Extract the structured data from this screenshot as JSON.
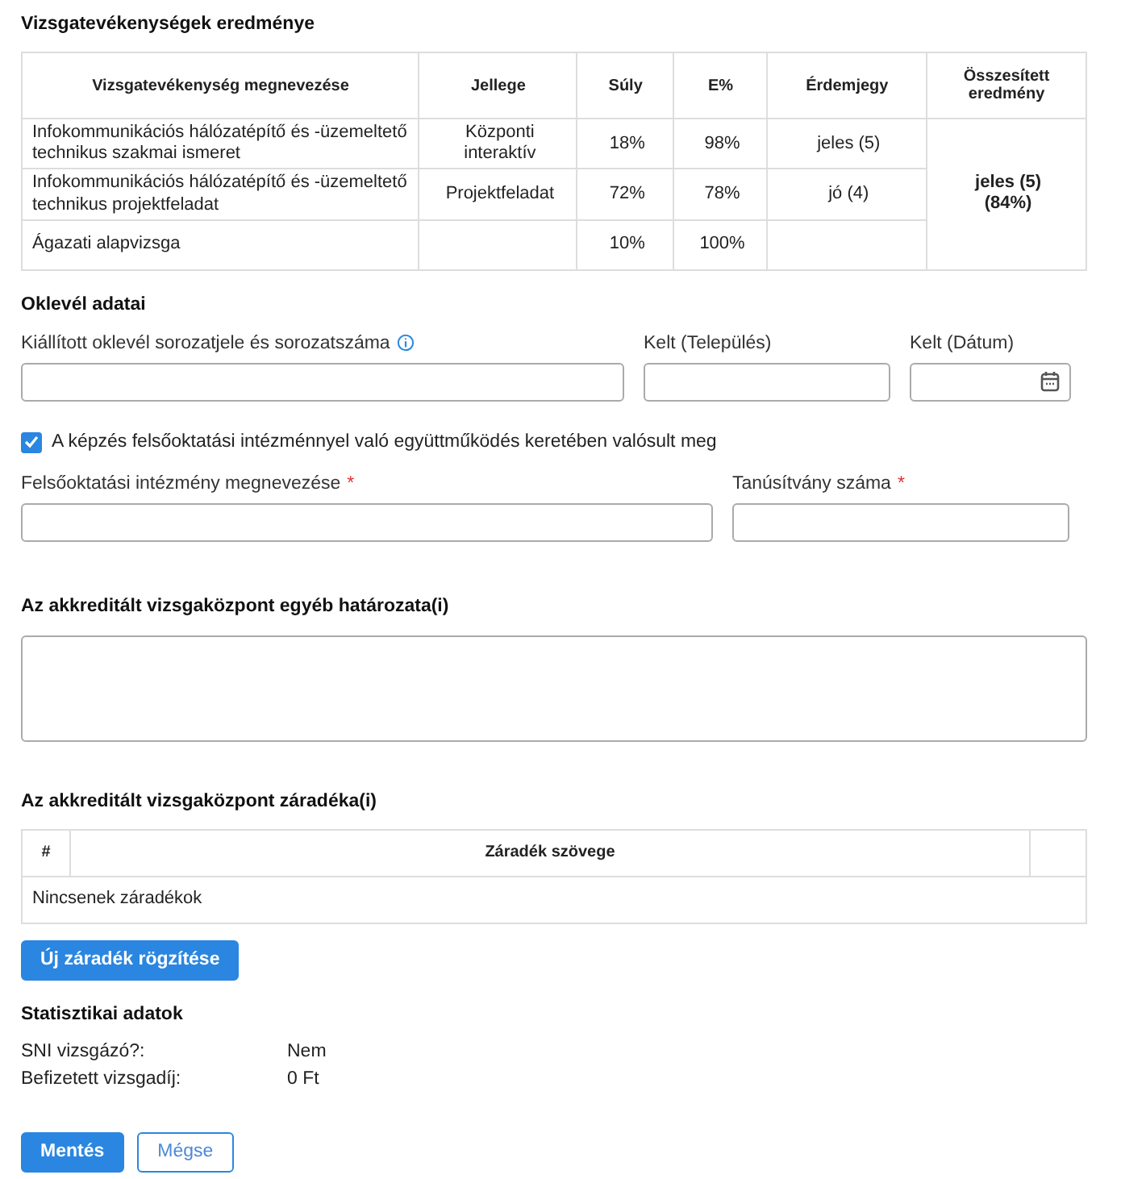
{
  "results": {
    "title": "Vizsgatevékenységek eredménye",
    "columns": [
      "Vizsgatevékenység megnevezése",
      "Jellege",
      "Súly",
      "E%",
      "Érdemjegy",
      "Összesített eredmény"
    ],
    "rows": [
      {
        "name": "Infokommunikációs hálózatépítő és -üzemeltető technikus szakmai ismeret",
        "type": "Központi interaktív",
        "weight": "18%",
        "percent": "98%",
        "grade": "jeles (5)"
      },
      {
        "name": "Infokommunikációs hálózatépítő és -üzemeltető technikus projektfeladat",
        "type": "Projektfeladat",
        "weight": "72%",
        "percent": "78%",
        "grade": "jó (4)"
      },
      {
        "name": "Ágazati alapvizsga",
        "type": "",
        "weight": "10%",
        "percent": "100%",
        "grade": ""
      }
    ],
    "summary": [
      "jeles (5)",
      "(84%)"
    ]
  },
  "diploma": {
    "title": "Oklevél adatai",
    "fields": [
      {
        "label": "Kiállított oklevél sorozatjele és sorozatszáma",
        "kind": "text",
        "info": true
      },
      {
        "label": "Kelt (Település)",
        "kind": "text",
        "info": false
      },
      {
        "label": "Kelt (Dátum)",
        "kind": "date",
        "info": false
      }
    ],
    "checkbox": {
      "label": "A képzés felsőoktatási intézménnyel való együttműködés keretében valósult meg",
      "checked": true
    },
    "fields2": [
      {
        "label": "Felsőoktatási intézmény megnevezése",
        "kind": "text",
        "info": false,
        "required_mark": "*"
      },
      {
        "label": "Tanúsítvány száma",
        "kind": "text",
        "info": false,
        "required_mark": "*"
      }
    ]
  },
  "resolution": {
    "title": "Az akkreditált vizsgaközpont egyéb határozata(i)"
  },
  "clauses": {
    "title": "Az akkreditált vizsgaközpont záradéka(i)",
    "columns": [
      "#",
      "Záradék szövege"
    ],
    "empty": "Nincsenek záradékok",
    "add_button": "Új záradék rögzítése"
  },
  "stats": {
    "title": "Statisztikai adatok",
    "rows": [
      {
        "label": "SNI vizsgázó?:",
        "value": "Nem"
      },
      {
        "label": "Befizetett vizsgadíj:",
        "value": "0 Ft"
      }
    ]
  },
  "buttons": [
    {
      "label": "Mentés",
      "kind": "primary"
    },
    {
      "label": "Mégse",
      "kind": "secondary"
    }
  ]
}
